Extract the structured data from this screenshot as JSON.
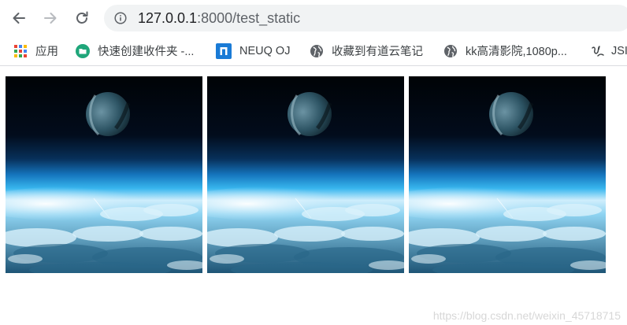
{
  "toolbar": {
    "url_host": "127.0.0.1",
    "url_rest": ":8000/test_static"
  },
  "bookmarks": [
    {
      "label": "应用",
      "icon": "apps-grid-icon"
    },
    {
      "label": "快速创建收件夹 -...",
      "icon": "folder-app-icon"
    },
    {
      "label": "NEUQ OJ",
      "icon": "neuq-logo-icon"
    },
    {
      "label": "收藏到有道云笔记",
      "icon": "globe-icon"
    },
    {
      "label": "kk高清影院,1080p...",
      "icon": "globe-icon"
    },
    {
      "label": "JSI",
      "icon": "bookmark-glyph-icon"
    }
  ],
  "content": {
    "images": [
      {
        "subject": "planet over clouds"
      },
      {
        "subject": "planet over clouds"
      },
      {
        "subject": "planet over clouds"
      }
    ],
    "watermark": "https://blog.csdn.net/weixin_45718715"
  },
  "colors": {
    "omnibox": "#f1f3f4",
    "icon_gray": "#5f6368",
    "bookmark_divider": "#dadce0"
  }
}
